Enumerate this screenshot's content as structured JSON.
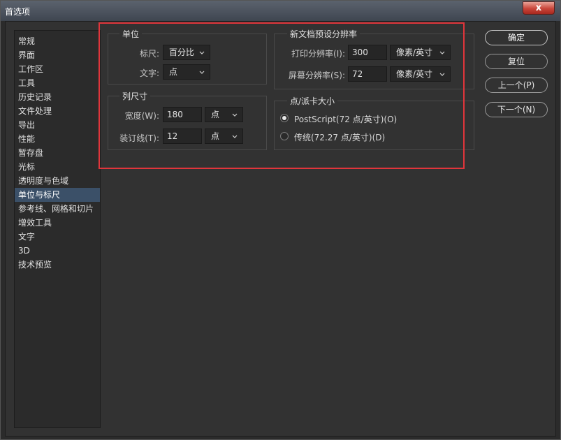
{
  "window": {
    "title": "首选项",
    "close_glyph": "x"
  },
  "sidebar": {
    "items": [
      {
        "label": "常规"
      },
      {
        "label": "界面"
      },
      {
        "label": "工作区"
      },
      {
        "label": "工具"
      },
      {
        "label": "历史记录"
      },
      {
        "label": "文件处理"
      },
      {
        "label": "导出"
      },
      {
        "label": "性能"
      },
      {
        "label": "暂存盘"
      },
      {
        "label": "光标"
      },
      {
        "label": "透明度与色域"
      },
      {
        "label": "单位与标尺"
      },
      {
        "label": "参考线、网格和切片"
      },
      {
        "label": "增效工具"
      },
      {
        "label": "文字"
      },
      {
        "label": "3D"
      },
      {
        "label": "技术预览"
      }
    ],
    "selected": "单位与标尺"
  },
  "units": {
    "legend": "单位",
    "ruler_label": "标尺:",
    "ruler_value": "百分比",
    "type_label": "文字:",
    "type_value": "点"
  },
  "column_size": {
    "legend": "列尺寸",
    "width_label": "宽度(W):",
    "width_value": "180",
    "width_unit": "点",
    "gutter_label": "装订线(T):",
    "gutter_value": "12",
    "gutter_unit": "点"
  },
  "new_doc_resolution": {
    "legend": "新文档预设分辨率",
    "print_label": "打印分辨率(I):",
    "print_value": "300",
    "print_unit": "像素/英寸",
    "screen_label": "屏幕分辨率(S):",
    "screen_value": "72",
    "screen_unit": "像素/英寸"
  },
  "point_size": {
    "legend": "点/派卡大小",
    "option_postscript": "PostScript(72 点/英寸)(O)",
    "option_traditional": "传统(72.27 点/英寸)(D)",
    "selected": "postscript"
  },
  "buttons": {
    "ok": "确定",
    "reset": "复位",
    "prev": "上一个(P)",
    "next": "下一个(N)"
  },
  "colors": {
    "highlight": "#e0353b",
    "selected_item": "#3b5068"
  }
}
